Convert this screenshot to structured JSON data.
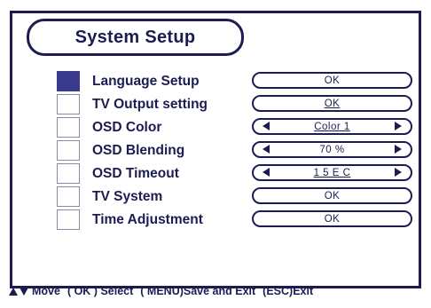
{
  "title": "System Setup",
  "colors": {
    "frame": "#1c1c52",
    "selected_checkbox": "#3a3a8e",
    "checkbox_border": "#8a8aa6",
    "background": "#ffffff"
  },
  "menu": {
    "items": [
      {
        "label": "Language Setup",
        "value": "OK",
        "selected": true,
        "type": "button"
      },
      {
        "label": "TV Output setting",
        "value": "OK",
        "selected": false,
        "type": "button"
      },
      {
        "label": "OSD Color",
        "value": "Color 1",
        "selected": false,
        "type": "selector"
      },
      {
        "label": "OSD Blending",
        "value": "70 %",
        "selected": false,
        "type": "selector"
      },
      {
        "label": "OSD Timeout",
        "value": "1 5 E C",
        "selected": false,
        "type": "selector"
      },
      {
        "label": "TV System",
        "value": "OK",
        "selected": false,
        "type": "button"
      },
      {
        "label": "Time Adjustment",
        "value": "OK",
        "selected": false,
        "type": "button"
      }
    ]
  },
  "footer": {
    "icons": [
      "up-arrow-icon",
      "down-arrow-icon"
    ],
    "move": "Move",
    "select": "( OK ) Select",
    "save_exit": "( MENU)Save and Exit",
    "exit": "(ESC)Exit"
  }
}
